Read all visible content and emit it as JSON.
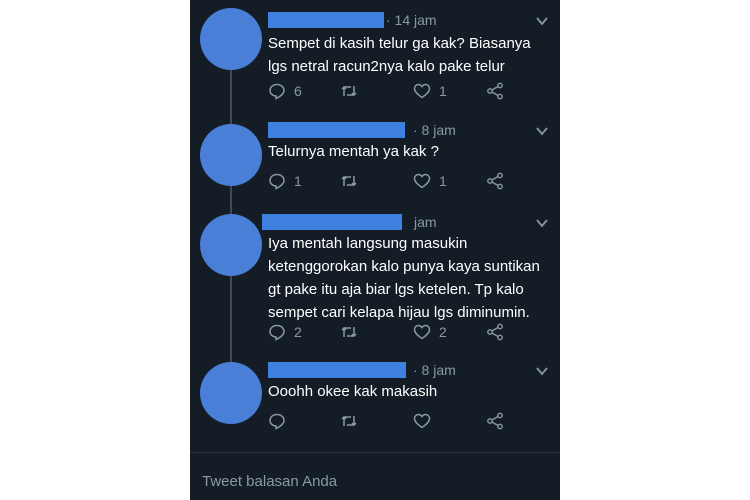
{
  "colors": {
    "background": "#141d26",
    "text": "#ffffff",
    "muted": "#8899a6",
    "redaction": "#3f7fe0"
  },
  "tweets": [
    {
      "time": "· 14 jam",
      "text": "Sempet di kasih telur ga kak? Biasanya\nlgs netral racun2nya kalo pake telur",
      "reply_count": "6",
      "retweet_count": "",
      "like_count": "1"
    },
    {
      "time": "· 8 jam",
      "text": "Telurnya mentah ya kak ?",
      "reply_count": "1",
      "retweet_count": "",
      "like_count": "1"
    },
    {
      "time": "jam",
      "text": "Iya mentah langsung masukin\nketenggorokan kalo punya kaya suntikan\ngt pake itu aja biar lgs ketelen. Tp kalo\nsempet cari kelapa hijau lgs diminumin.",
      "reply_count": "2",
      "retweet_count": "",
      "like_count": "2"
    },
    {
      "time": "· 8 jam",
      "text": "Ooohh okee kak makasih",
      "reply_count": "",
      "retweet_count": "",
      "like_count": ""
    }
  ],
  "reply_box": {
    "placeholder": "Tweet balasan Anda"
  },
  "icons": {
    "reply": "reply-icon",
    "retweet": "retweet-icon",
    "like": "heart-icon",
    "share": "share-icon",
    "menu": "chevron-down-icon"
  }
}
